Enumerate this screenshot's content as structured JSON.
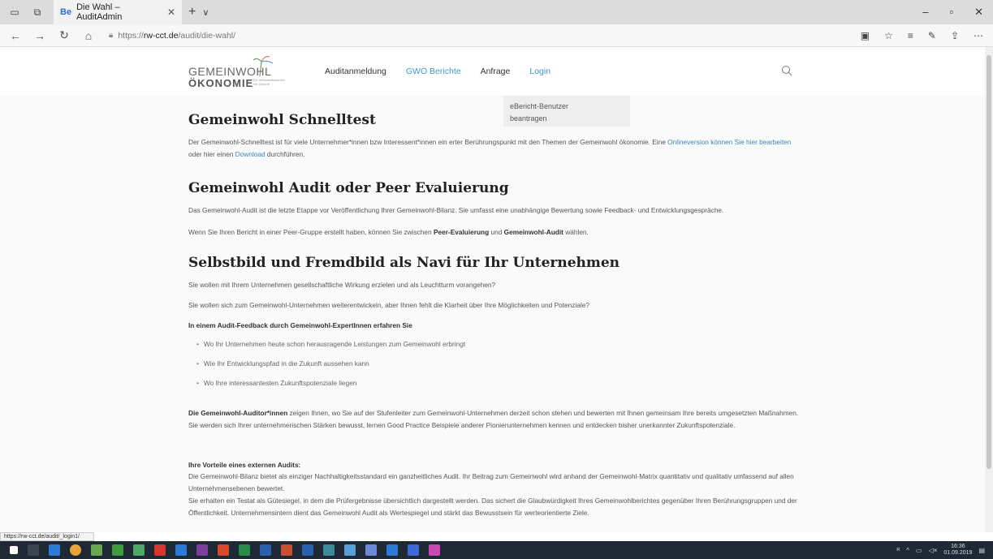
{
  "browser": {
    "tab_title": "Die Wahl – AuditAdmin",
    "tab_favicon": "Be",
    "url_prefix": "https://",
    "url_host": "rw-cct.de",
    "url_path": "/audit/die-wahl/"
  },
  "header": {
    "logo_top": "GEMEINWOHL",
    "logo_bottom": "ÖKONOMIE",
    "logo_small": "Ein Wirtschaftsmodell mit Zukunft",
    "menu": [
      {
        "label": "Auditanmeldung"
      },
      {
        "label": "GWÖ Berichte"
      },
      {
        "label": "Anfrage"
      },
      {
        "label": "Login"
      }
    ],
    "dropdown_line1": "eBericht-Benutzer",
    "dropdown_line2": "beantragen"
  },
  "content": {
    "h1": "Gemeinwohl Schnelltest",
    "p1_a": "Der Gemeinwohl-Schnelltest ist für viele Unternehmer*innen bzw Interessent*innen ein erter Berührungspunkt mit den Themen der Gemeinwohl ökonomie. Eine ",
    "p1_link1": "Onlineversion können Sie hier bearbeiten",
    "p1_b": " oder hier einen ",
    "p1_link2": "Download",
    "p1_c": " durchführen.",
    "h2": "Gemeinwohl Audit oder Peer Evaluierung",
    "p2": "Das Gemeinwohl-Audit ist die letzte Etappe vor Veröffentlichung Ihrer Gemeinwohl-Bilanz. Sie umfasst eine unabhängige Bewertung sowie Feedback- und Entwicklungsgespräche.",
    "p3_a": "Wenn Sie Ihren Bericht in einer Peer-Gruppe erstellt haben, können Sie zwischen ",
    "p3_b1": "Peer-Evaluierung",
    "p3_mid": " und ",
    "p3_b2": "Gemeinwohl-Audit",
    "p3_c": " wählen.",
    "h3": "Selbstbild und Fremdbild als Navi für Ihr Unternehmen",
    "p4": "Sie wollen mit Ihrem Unternehmen gesellschaftliche Wirkung erzielen und als Leuchtturm vorangehen?",
    "p5": "Sie wollen sich zum Gemeinwohl-Unternehmen weiterentwickeln, aber Ihnen fehlt die Klarheit über Ihre Möglichkeiten und Potenziale?",
    "p6": "In einem Audit-Feedback durch Gemeinwohl-ExpertInnen erfahren Sie",
    "bullets": [
      "Wo Ihr Unternehmen heute schon herausragende Leistungen zum Gemeinwohl erbringt",
      "Wie Ihr Entwicklungspfad in die Zukunft aussehen kann",
      "Wo Ihre interessantesten Zukunftspotenziale liegen"
    ],
    "p7_b": "Die Gemeinwohl-Auditor*innen",
    "p7": " zeigen Ihnen, wo Sie auf der Stufenleiter zum Gemeinwohl-Unternehmen derzeit schon stehen und bewerten mit Ihnen gemeinsam Ihre bereits umgesetzten Maßnahmen. Sie werden sich Ihrer unternehmerischen Stärken bewusst, lernen Good Practice Beispiele anderer Pionierunternehmen kennen und entdecken bisher unerkannter Zukunftspotenziale.",
    "p8_title": "Ihre Vorteile eines externen Audits:",
    "p8_1": "Die Gemeinwohl-Bilanz bietet als einziger Nachhaltigkeitsstandard ein ganzheitliches Audit. Ihr Beitrag zum Gemeinwohl wird anhand der Gemeinwohl-Matrix quantitativ und qualitativ umfassend auf allen Unternehmensebenen bewertet.",
    "p8_2": "Sie erhalten ein Testat als Gütesiegel, in dem die Prüfergebnisse übersichtlich dargestellt werden. Das sichert die Glaubwürdigkeit Ihres Gemeinwohlberichtes gegenüber Ihren Berührungsgruppen und der Öffentlichkeit. Unternehmensintern dient das Gemeinwohl Audit als Wertespiegel und stärkt das Bewusstsein für werteorientierte Ziele."
  },
  "status_url": "https://rw-cct.de/audit/_login1/",
  "taskbar": {
    "time": "16:36",
    "date": "01.09.2019"
  }
}
